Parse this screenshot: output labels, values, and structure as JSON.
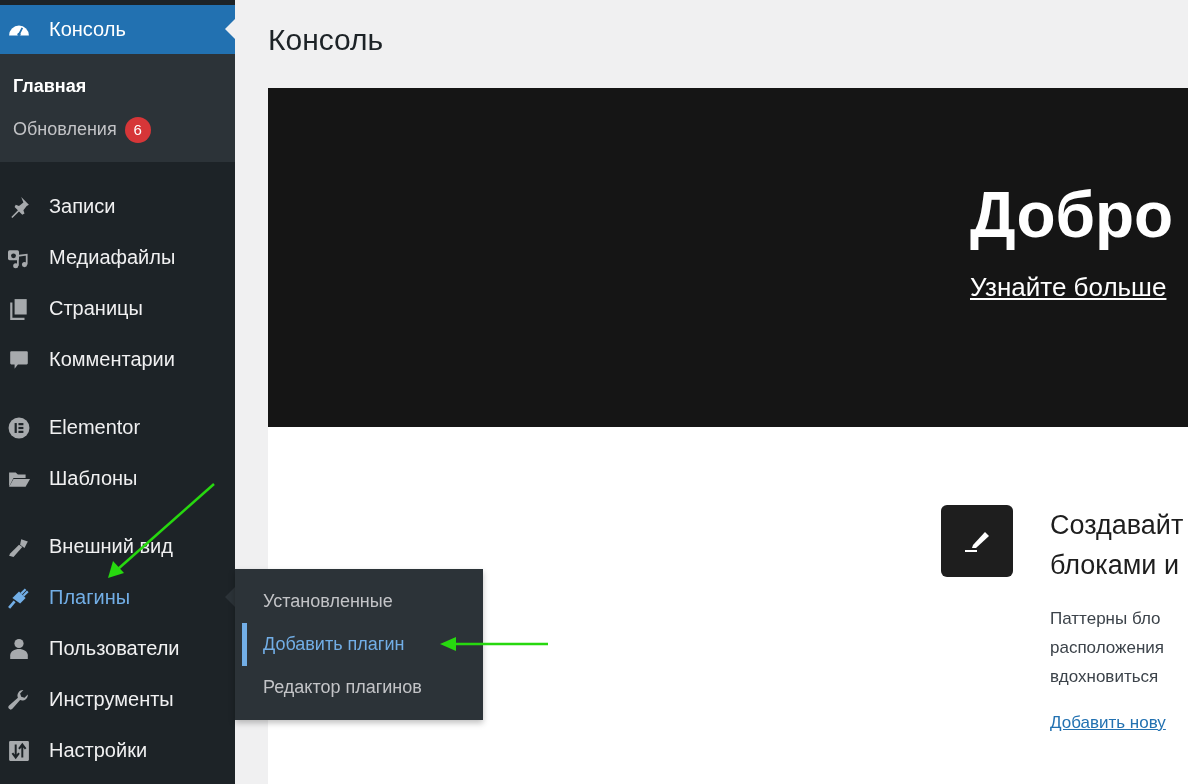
{
  "sidebar": {
    "groups": [
      {
        "items": [
          {
            "label": "Консоль",
            "selected": true,
            "hovered": false,
            "submenu": [
              {
                "label": "Главная",
                "selected": true
              },
              {
                "label": "Обновления",
                "selected": false,
                "badge": "6"
              }
            ]
          }
        ]
      },
      {
        "items": [
          {
            "label": "Записи",
            "selected": false,
            "hovered": false
          },
          {
            "label": "Медиафайлы",
            "selected": false,
            "hovered": false
          },
          {
            "label": "Страницы",
            "selected": false,
            "hovered": false
          },
          {
            "label": "Комментарии",
            "selected": false,
            "hovered": false
          }
        ]
      },
      {
        "items": [
          {
            "label": "Elementor",
            "selected": false,
            "hovered": false
          },
          {
            "label": "Шаблоны",
            "selected": false,
            "hovered": false
          }
        ]
      },
      {
        "items": [
          {
            "label": "Внешний вид",
            "selected": false,
            "hovered": false
          },
          {
            "label": "Плагины",
            "selected": false,
            "hovered": true,
            "flyout": [
              {
                "label": "Установленные",
                "selected": false
              },
              {
                "label": "Добавить плагин",
                "selected": true
              },
              {
                "label": "Редактор плагинов",
                "selected": false
              }
            ]
          },
          {
            "label": "Пользователи",
            "selected": false,
            "hovered": false
          },
          {
            "label": "Инструменты",
            "selected": false,
            "hovered": false
          },
          {
            "label": "Настройки",
            "selected": false,
            "hovered": false
          }
        ]
      }
    ]
  },
  "page": {
    "title": "Консоль"
  },
  "welcome_panel": {
    "heading": "Добро",
    "link": "Узнайте больше"
  },
  "feature": {
    "heading": "Создавайт\nблоками и",
    "text": "Паттерны бло\nрасположения\nвдохновиться",
    "link": "Добавить нову"
  }
}
